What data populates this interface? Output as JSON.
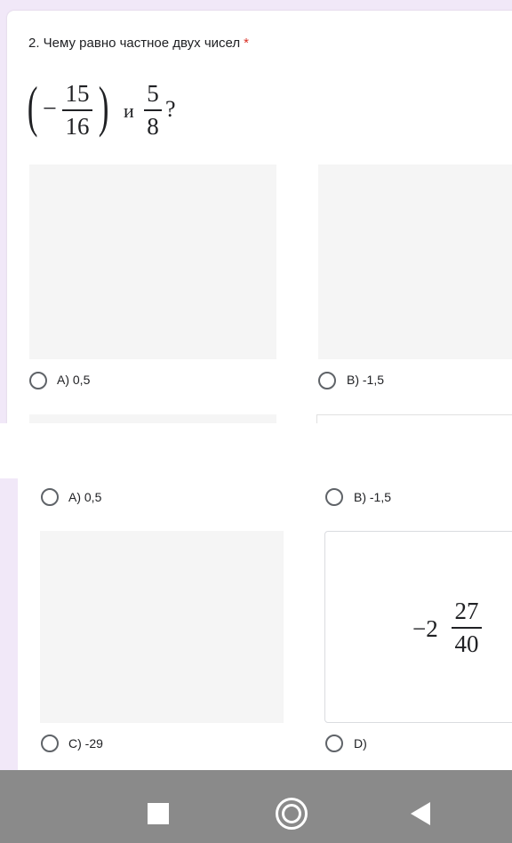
{
  "question": {
    "title": "2. Чему равно частное двух чисел",
    "required_mark": "*",
    "formula": {
      "open_paren": "(",
      "minus": "−",
      "frac1_num": "15",
      "frac1_den": "16",
      "close_paren": ")",
      "conjunction": "и",
      "frac2_num": "5",
      "frac2_den": "8",
      "question_mark": "?"
    }
  },
  "options_top": [
    {
      "label": "A) 0,5"
    },
    {
      "label": "B) -1,5"
    }
  ],
  "options_bottom": [
    {
      "label": "A) 0,5"
    },
    {
      "label": "B) -1,5"
    },
    {
      "label": "C) -29"
    },
    {
      "label": "D)"
    }
  ],
  "option_d_image": {
    "whole": "−2",
    "num": "27",
    "den": "40"
  },
  "colors": {
    "background_tint": "#f1e8f8",
    "required": "#d93025",
    "navbar": "#8a8a8a"
  },
  "navbar": {
    "icons": [
      "recents-square-icon",
      "home-circle-icon",
      "back-triangle-icon"
    ]
  }
}
